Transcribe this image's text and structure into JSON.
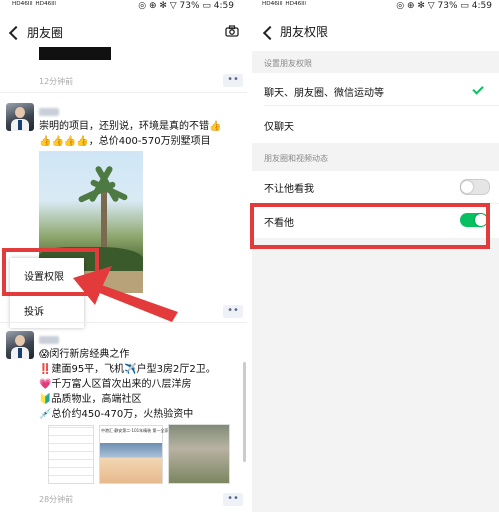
{
  "colors": {
    "accent_green": "#07c160",
    "highlight_red": "#e33b3b",
    "link_blue": "#5a6b8f"
  },
  "status_bar": {
    "left": "ᴴᴰ⁴⁶ᴵˡˡ ᴴᴰ⁴⁶ᴵˡˡ",
    "right_left_screen": "◎ ⊕ ✻ ▽ 73% ▭ 4:59",
    "right_right_screen": "◎ ⊕ ✻ ▽ 73% ▭ 4:59"
  },
  "moments": {
    "title": "朋友圈",
    "camera_icon": "camera-icon",
    "post0_time": "12分钟前",
    "more_label": "••",
    "post1": {
      "lines": [
        "崇明的项目，还别说，环境是真的不错👍",
        "👍👍👍👍，总价400-570万别墅项目"
      ]
    },
    "popup_items": [
      "设置权限",
      "投诉"
    ],
    "post2": {
      "lines": [
        "😱闵行新房经典之作",
        "‼️建面95平，飞机✈️户型3房2厅2卫。",
        "💗千万富人区首次出来的八层洋房",
        "🔰品质物业，高端社区",
        "💉总价约450-470万，火热验资中"
      ],
      "image_caption": "中港汇·静安第二·101年精装 第一全家居",
      "time": "28分钟前"
    }
  },
  "permissions": {
    "title": "朋友权限",
    "section1_header": "设置朋友权限",
    "option1": "聊天、朋友圈、微信运动等",
    "option2": "仅聊天",
    "section2_header": "朋友圈和视频动态",
    "row_block_me": "不让他看我",
    "row_hide_him": "不看他",
    "block_me_on": false,
    "hide_him_on": true
  }
}
